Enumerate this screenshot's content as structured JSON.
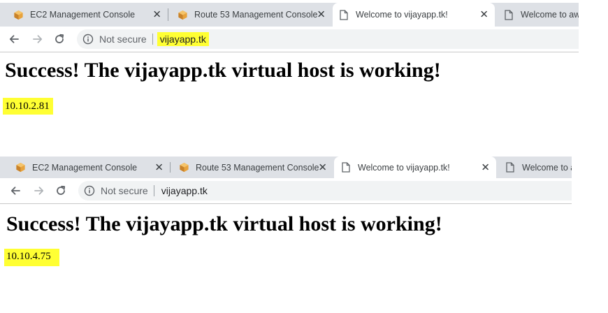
{
  "screenshots": [
    {
      "tabs": [
        {
          "label": "EC2 Management Console",
          "icon": "aws-cube-icon"
        },
        {
          "label": "Route 53 Management Console",
          "icon": "aws-cube-icon"
        },
        {
          "label": "Welcome to vijayapp.tk!",
          "icon": "page-icon",
          "active": true
        },
        {
          "label": "Welcome to aws",
          "icon": "page-icon"
        }
      ],
      "address_bar": {
        "security": "Not secure",
        "url": "vijayapp.tk",
        "url_highlighted": true
      },
      "page": {
        "heading": "Success! The vijayapp.tk virtual host is working!",
        "ip": "10.10.2.81"
      }
    },
    {
      "tabs": [
        {
          "label": "EC2 Management Console",
          "icon": "aws-cube-icon"
        },
        {
          "label": "Route 53 Management Console",
          "icon": "aws-cube-icon"
        },
        {
          "label": "Welcome to vijayapp.tk!",
          "icon": "page-icon",
          "active": true
        },
        {
          "label": "Welcome to a",
          "icon": "page-icon"
        }
      ],
      "address_bar": {
        "security": "Not secure",
        "url": "vijayapp.tk",
        "url_highlighted": false
      },
      "page": {
        "heading": "Success! The vijayapp.tk virtual host is working!",
        "ip": "10.10.4.75"
      }
    }
  ],
  "colors": {
    "highlight": "#ffff33",
    "tab_strip": "#dee1e6",
    "aws_orange": "#e8a33d"
  }
}
